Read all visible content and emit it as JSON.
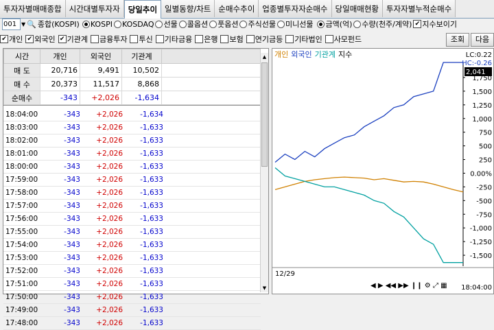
{
  "tabs": [
    "투자자별매매종합",
    "시간대별투자자",
    "당일추이",
    "일별동향/차트",
    "순매수추이",
    "업종별투자자순매수",
    "당일매매현황",
    "투자자별누적순매수"
  ],
  "active_tab": 2,
  "market": {
    "code": "001",
    "name": "종합(KOSPI)"
  },
  "market_options": [
    "KOSPI",
    "KOSDAQ",
    "선물",
    "콜옵션",
    "풋옵션",
    "주식선물",
    "미니선물"
  ],
  "unit_options": [
    "금액(억)",
    "수량(천주/계약)"
  ],
  "index_toggle": "지수보이기",
  "investor_filters": [
    "개인",
    "외국인",
    "기관계",
    "금융투자",
    "투신",
    "기타금융",
    "은행",
    "보험",
    "연기금등",
    "기타법인",
    "사모펀드"
  ],
  "buttons": {
    "search": "조회",
    "next": "다음"
  },
  "table": {
    "headers": [
      "시간",
      "개인",
      "외국인",
      "기관계"
    ],
    "summary": [
      {
        "label": "매 도",
        "values": [
          "20,716",
          "9,491",
          "10,502"
        ]
      },
      {
        "label": "매 수",
        "values": [
          "20,373",
          "11,517",
          "8,868"
        ]
      },
      {
        "label": "순매수",
        "values": [
          "-343",
          "+2,026",
          "-1,634"
        ]
      }
    ],
    "rows": [
      [
        "18:04:00",
        "-343",
        "+2,026",
        "-1,634"
      ],
      [
        "18:03:00",
        "-343",
        "+2,026",
        "-1,633"
      ],
      [
        "18:02:00",
        "-343",
        "+2,026",
        "-1,633"
      ],
      [
        "18:01:00",
        "-343",
        "+2,026",
        "-1,633"
      ],
      [
        "18:00:00",
        "-343",
        "+2,026",
        "-1,633"
      ],
      [
        "17:59:00",
        "-343",
        "+2,026",
        "-1,633"
      ],
      [
        "17:58:00",
        "-343",
        "+2,026",
        "-1,633"
      ],
      [
        "17:57:00",
        "-343",
        "+2,026",
        "-1,633"
      ],
      [
        "17:56:00",
        "-343",
        "+2,026",
        "-1,633"
      ],
      [
        "17:55:00",
        "-343",
        "+2,026",
        "-1,633"
      ],
      [
        "17:54:00",
        "-343",
        "+2,026",
        "-1,633"
      ],
      [
        "17:53:00",
        "-343",
        "+2,026",
        "-1,633"
      ],
      [
        "17:52:00",
        "-343",
        "+2,026",
        "-1,633"
      ],
      [
        "17:51:00",
        "-343",
        "+2,026",
        "-1,633"
      ],
      [
        "17:50:00",
        "-343",
        "+2,026",
        "-1,633"
      ],
      [
        "17:49:00",
        "-343",
        "+2,026",
        "-1,633"
      ],
      [
        "17:48:00",
        "-343",
        "+2,026",
        "-1,633"
      ]
    ]
  },
  "chart": {
    "legend": [
      "개인",
      "외국인",
      "기관계",
      "지수"
    ],
    "colors": {
      "개인": "#d08000",
      "외국인": "#1a3fbf",
      "기관계": "#00a0a0",
      "지수": "#000000"
    },
    "lc_label": "LC:0.22",
    "hc_label": "HC:-0.26",
    "current_value": "2,041",
    "x_start": "12/29",
    "x_end": "18:04:00",
    "yticks": [
      "1,750",
      "1,500",
      "1,250",
      "1,000",
      "750",
      "500",
      "250",
      "0.00%",
      "-250",
      "-500",
      "-750",
      "-1,000",
      "-1,250",
      "-1,500"
    ]
  },
  "chart_data": {
    "type": "line",
    "series": [
      {
        "name": "개인",
        "values": [
          -300,
          -250,
          -200,
          -150,
          -120,
          -100,
          -80,
          -70,
          -80,
          -90,
          -120,
          -100,
          -130,
          -160,
          -150,
          -160,
          -200,
          -250,
          -300,
          -343
        ]
      },
      {
        "name": "외국인",
        "values": [
          200,
          350,
          250,
          400,
          300,
          450,
          550,
          650,
          700,
          850,
          950,
          1050,
          1200,
          1250,
          1400,
          1450,
          1500,
          2026,
          2026,
          2026
        ]
      },
      {
        "name": "기관계",
        "values": [
          100,
          -50,
          -100,
          -150,
          -200,
          -250,
          -250,
          -300,
          -350,
          -400,
          -500,
          -550,
          -700,
          -800,
          -1000,
          -1200,
          -1300,
          -1634,
          -1634,
          -1634
        ]
      }
    ]
  }
}
